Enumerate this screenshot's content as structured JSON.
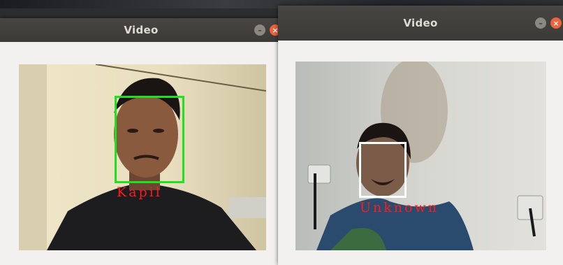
{
  "windows": [
    {
      "title": "Video",
      "detection": {
        "label": "Kapil",
        "box_color": "#20e020",
        "label_color": "#ff1a1a"
      }
    },
    {
      "title": "Video",
      "detection": {
        "label": "Unknown",
        "box_color": "#ffffff",
        "label_color": "#ff1a1a"
      }
    }
  ],
  "icons": {
    "minimize": "minimize-icon",
    "close": "close-icon"
  }
}
